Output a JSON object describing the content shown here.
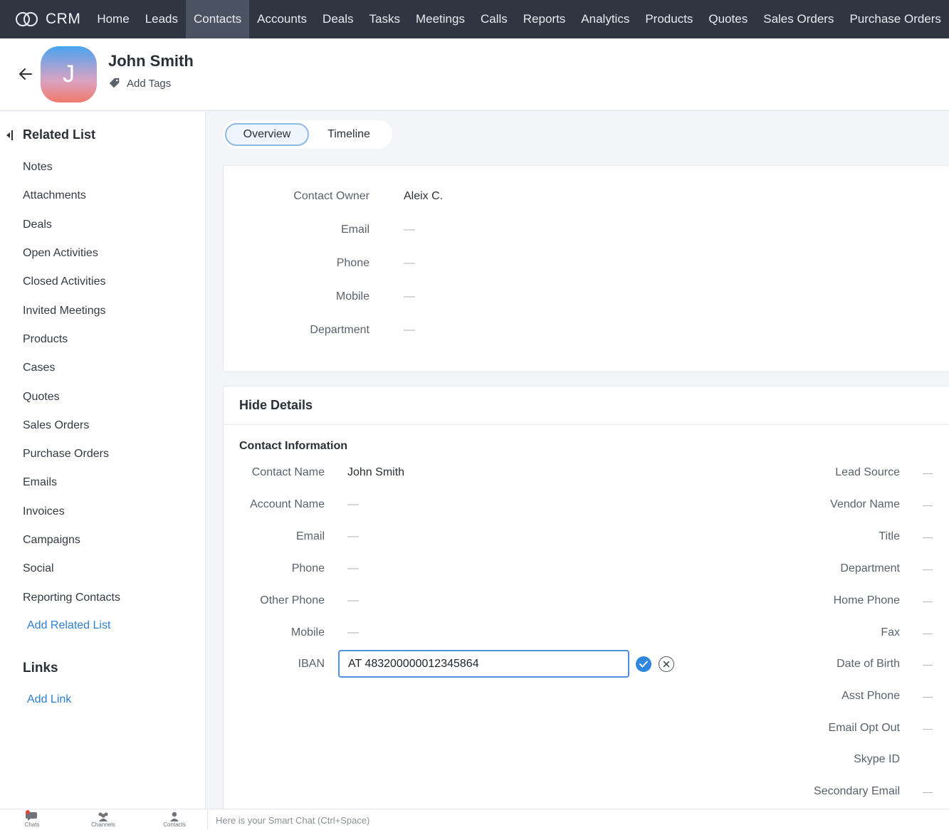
{
  "app": {
    "brand": "CRM",
    "nav": [
      "Home",
      "Leads",
      "Contacts",
      "Accounts",
      "Deals",
      "Tasks",
      "Meetings",
      "Calls",
      "Reports",
      "Analytics",
      "Products",
      "Quotes",
      "Sales Orders",
      "Purchase Orders"
    ],
    "active_nav": "Contacts"
  },
  "header": {
    "avatar_initial": "J",
    "name": "John Smith",
    "add_tags": "Add Tags"
  },
  "sidebar": {
    "title": "Related List",
    "items": [
      "Notes",
      "Attachments",
      "Deals",
      "Open Activities",
      "Closed Activities",
      "Invited Meetings",
      "Products",
      "Cases",
      "Quotes",
      "Sales Orders",
      "Purchase Orders",
      "Emails",
      "Invoices",
      "Campaigns",
      "Social",
      "Reporting Contacts"
    ],
    "add_related": "Add Related List",
    "links_title": "Links",
    "add_link": "Add Link"
  },
  "tabs": {
    "overview": "Overview",
    "timeline": "Timeline",
    "active": "Overview"
  },
  "overview": {
    "fields": [
      {
        "label": "Contact Owner",
        "value": "Aleix C."
      },
      {
        "label": "Email",
        "value": "—"
      },
      {
        "label": "Phone",
        "value": "—"
      },
      {
        "label": "Mobile",
        "value": "—"
      },
      {
        "label": "Department",
        "value": "—"
      }
    ]
  },
  "details": {
    "toggle": "Hide Details",
    "section": "Contact Information",
    "left": [
      {
        "label": "Contact Name",
        "value": "John Smith"
      },
      {
        "label": "Account Name",
        "value": "—"
      },
      {
        "label": "Email",
        "value": "—"
      },
      {
        "label": "Phone",
        "value": "—"
      },
      {
        "label": "Other Phone",
        "value": "—"
      },
      {
        "label": "Mobile",
        "value": "—"
      }
    ],
    "iban": {
      "label": "IBAN",
      "value": "AT 483200000012345864"
    },
    "right": [
      {
        "label": "Lead Source",
        "value": "—"
      },
      {
        "label": "Vendor Name",
        "value": "—"
      },
      {
        "label": "Title",
        "value": "—"
      },
      {
        "label": "Department",
        "value": "—"
      },
      {
        "label": "Home Phone",
        "value": "—"
      },
      {
        "label": "Fax",
        "value": "—"
      },
      {
        "label": "Date of Birth",
        "value": "—"
      },
      {
        "label": "Asst Phone",
        "value": "—"
      },
      {
        "label": "Email Opt Out",
        "value": "—"
      },
      {
        "label": "Skype ID",
        "value": ""
      },
      {
        "label": "Secondary Email",
        "value": "—"
      }
    ]
  },
  "bottombar": {
    "chats": "Chats",
    "channels": "Channels",
    "contacts": "Contacts",
    "smart_chat": "Here is your Smart Chat (Ctrl+Space)"
  },
  "colors": {
    "nav_bg": "#2f3541",
    "accent": "#2f86dc",
    "link": "#2e7fd1"
  }
}
